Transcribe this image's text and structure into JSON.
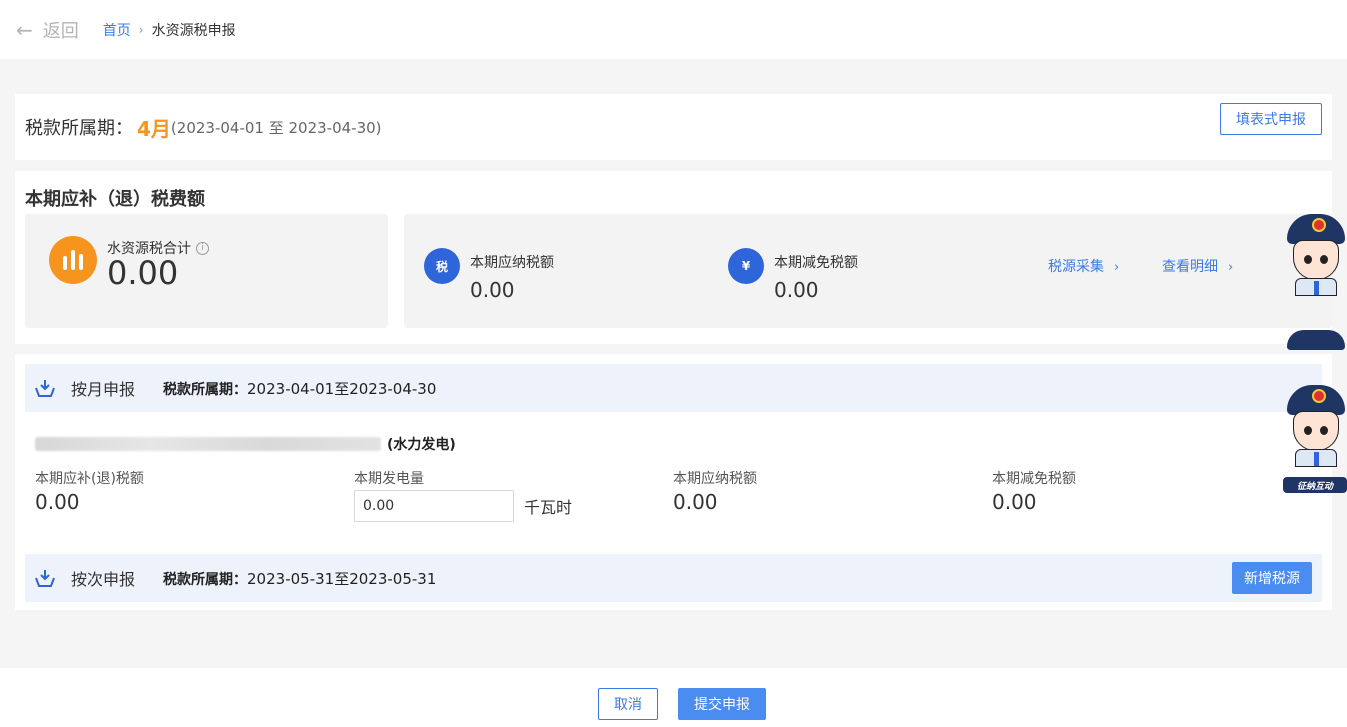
{
  "header": {
    "back_label": "返回",
    "breadcrumb_home": "首页",
    "breadcrumb_current": "水资源税申报"
  },
  "period": {
    "label": "税款所属期：",
    "month": "4月",
    "range": "(2023-04-01 至 2023-04-30)",
    "fill_button": "填表式申报"
  },
  "summary": {
    "title": "本期应补（退）税费额",
    "total_label": "水资源税合计",
    "total_value": "0.00",
    "payable_label": "本期应纳税额",
    "payable_value": "0.00",
    "payable_icon_text": "税",
    "reduction_label": "本期减免税额",
    "reduction_value": "0.00",
    "reduction_icon_text": "¥",
    "link_collect": "税源采集",
    "link_detail": "查看明细"
  },
  "monthly": {
    "type": "按月申报",
    "period_label": "税款所属期：",
    "period_value": "2023-04-01至2023-04-30",
    "source_name": "(水力发电)",
    "fields": {
      "refund_label": "本期应补(退)税额",
      "refund_value": "0.00",
      "power_label": "本期发电量",
      "power_value": "0.00",
      "power_unit": "千瓦时",
      "payable_label": "本期应纳税额",
      "payable_value": "0.00",
      "reduction_label": "本期减免税额",
      "reduction_value": "0.00"
    }
  },
  "per_time": {
    "type": "按次申报",
    "period_label": "税款所属期：",
    "period_value": "2023-05-31至2023-05-31",
    "add_button": "新增税源"
  },
  "footer": {
    "cancel": "取消",
    "submit": "提交申报"
  },
  "mascot": {
    "tag": "征纳互动"
  },
  "colors": {
    "accent": "#3b7be6",
    "highlight": "#f7941d",
    "primary_button": "#4a8cf0"
  }
}
